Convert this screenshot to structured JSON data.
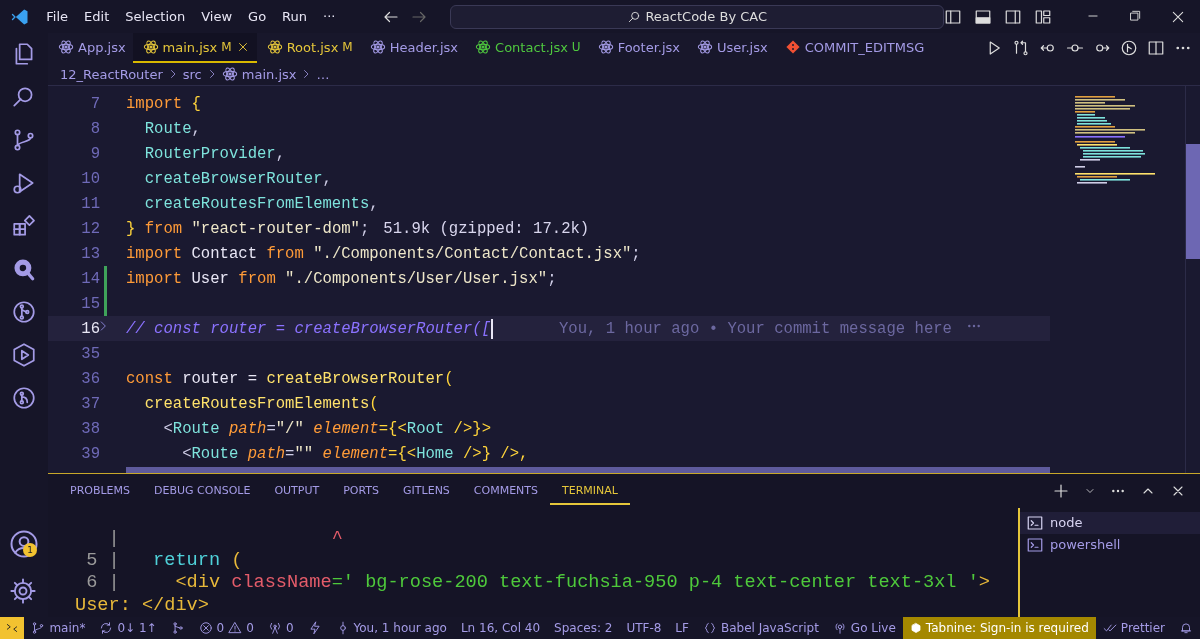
{
  "window": {
    "title": "ReactCode By CAC"
  },
  "menu": [
    "File",
    "Edit",
    "Selection",
    "View",
    "Go",
    "Run",
    "···"
  ],
  "tabs": [
    {
      "label": "App.jsx",
      "kind": "component",
      "selected": false
    },
    {
      "label": "main.jsx",
      "kind": "component",
      "status": "M",
      "selected": true
    },
    {
      "label": "Root.jsx",
      "kind": "component",
      "status": "M",
      "selected": false
    },
    {
      "label": "Header.jsx",
      "kind": "component",
      "selected": false
    },
    {
      "label": "Contact.jsx",
      "kind": "component",
      "status": "U",
      "selected": false
    },
    {
      "label": "Footer.jsx",
      "kind": "component",
      "selected": false
    },
    {
      "label": "User.jsx",
      "kind": "component",
      "selected": false
    },
    {
      "label": "COMMIT_EDITMSG",
      "kind": "git",
      "selected": false
    }
  ],
  "breadcrumbs": [
    "12_ReactRouter",
    "src",
    "main.jsx",
    "…"
  ],
  "code_lines": [
    {
      "number": "7",
      "git_added": false,
      "folded": false,
      "current": false,
      "tokens": [
        {
          "text": "import",
          "kind": "kw"
        },
        {
          "text": " {",
          "kind": "brace"
        }
      ]
    },
    {
      "number": "8",
      "git_added": false,
      "folded": false,
      "current": false,
      "tokens": [
        {
          "text": "  Route",
          "kind": "ident"
        },
        {
          "text": ",",
          "kind": "punc"
        }
      ]
    },
    {
      "number": "9",
      "git_added": false,
      "folded": false,
      "current": false,
      "tokens": [
        {
          "text": "  RouterProvider",
          "kind": "ident"
        },
        {
          "text": ",",
          "kind": "punc"
        }
      ]
    },
    {
      "number": "10",
      "git_added": false,
      "folded": false,
      "current": false,
      "tokens": [
        {
          "text": "  createBrowserRouter",
          "kind": "ident"
        },
        {
          "text": ",",
          "kind": "punc"
        }
      ]
    },
    {
      "number": "11",
      "git_added": false,
      "folded": false,
      "current": false,
      "tokens": [
        {
          "text": "  createRoutesFromElements",
          "kind": "ident"
        },
        {
          "text": ",",
          "kind": "punc"
        }
      ]
    },
    {
      "number": "12",
      "git_added": false,
      "folded": false,
      "current": false,
      "hint": "51.9k (gzipped: 17.2k)",
      "tokens": [
        {
          "text": "} ",
          "kind": "brace"
        },
        {
          "text": "from",
          "kind": "kw"
        },
        {
          "text": " \"react-router-dom\"",
          "kind": "str"
        },
        {
          "text": ";",
          "kind": "punc"
        }
      ]
    },
    {
      "number": "13",
      "git_added": false,
      "folded": false,
      "current": false,
      "tokens": [
        {
          "text": "import",
          "kind": "kw"
        },
        {
          "text": " Contact ",
          "kind": "name"
        },
        {
          "text": "from",
          "kind": "kw"
        },
        {
          "text": " \"./Components/Contact/Contact.jsx\"",
          "kind": "str"
        },
        {
          "text": ";",
          "kind": "punc"
        }
      ]
    },
    {
      "number": "14",
      "git_added": true,
      "folded": false,
      "current": false,
      "tokens": [
        {
          "text": "import",
          "kind": "kw"
        },
        {
          "text": " User ",
          "kind": "name"
        },
        {
          "text": "from",
          "kind": "kw"
        },
        {
          "text": " \"./Components/User/User.jsx\"",
          "kind": "str"
        },
        {
          "text": ";",
          "kind": "punc"
        }
      ]
    },
    {
      "number": "15",
      "git_added": true,
      "folded": false,
      "current": false
    },
    {
      "number": "16",
      "git_added": false,
      "folded": true,
      "current": true,
      "blame": "You, 1 hour ago • Your commit message here",
      "tokens": [
        {
          "text": "// const router = createBrowserRouter([",
          "kind": "comment"
        }
      ]
    },
    {
      "number": "35",
      "git_added": false,
      "folded": false,
      "current": false
    },
    {
      "number": "36",
      "git_added": false,
      "folded": false,
      "current": false,
      "tokens": [
        {
          "text": "const",
          "kind": "kw"
        },
        {
          "text": " router = ",
          "kind": "name"
        },
        {
          "text": "createBrowserRouter",
          "kind": "fn"
        },
        {
          "text": "(",
          "kind": "brace"
        }
      ]
    },
    {
      "number": "37",
      "git_added": false,
      "folded": false,
      "current": false,
      "tokens": [
        {
          "text": "  createRoutesFromElements",
          "kind": "fn"
        },
        {
          "text": "(",
          "kind": "brace"
        }
      ]
    },
    {
      "number": "38",
      "git_added": false,
      "folded": false,
      "current": false,
      "tokens": [
        {
          "text": "    <",
          "kind": "punc"
        },
        {
          "text": "Route",
          "kind": "tag"
        },
        {
          "text": " path",
          "kind": "attr"
        },
        {
          "text": "=",
          "kind": "punc"
        },
        {
          "text": "\"/\"",
          "kind": "str"
        },
        {
          "text": " element",
          "kind": "attr"
        },
        {
          "text": "={<",
          "kind": "brace"
        },
        {
          "text": "Root",
          "kind": "tag"
        },
        {
          "text": " />}>",
          "kind": "brace"
        }
      ]
    },
    {
      "number": "39",
      "git_added": false,
      "folded": false,
      "current": false,
      "tokens": [
        {
          "text": "      <",
          "kind": "punc"
        },
        {
          "text": "Route",
          "kind": "tag"
        },
        {
          "text": " path",
          "kind": "attr"
        },
        {
          "text": "=",
          "kind": "punc"
        },
        {
          "text": "\"\"",
          "kind": "str"
        },
        {
          "text": " element",
          "kind": "attr"
        },
        {
          "text": "={<",
          "kind": "brace"
        },
        {
          "text": "Home",
          "kind": "tag"
        },
        {
          "text": " />} />,",
          "kind": "brace"
        }
      ]
    }
  ],
  "panel_tabs": [
    {
      "label": "PROBLEMS",
      "selected": false
    },
    {
      "label": "DEBUG CONSOLE",
      "selected": false
    },
    {
      "label": "OUTPUT",
      "selected": false
    },
    {
      "label": "PORTS",
      "selected": false
    },
    {
      "label": "GITLENS",
      "selected": false
    },
    {
      "label": "COMMENTS",
      "selected": false
    },
    {
      "label": "TERMINAL",
      "selected": true
    }
  ],
  "terminal_lines": [
    [
      {
        "text": "   |                   ",
        "kind": "gray"
      },
      {
        "text": "^",
        "kind": "red"
      }
    ],
    [
      {
        "text": " 5 |   ",
        "kind": "gray"
      },
      {
        "text": "return",
        "kind": "cyan"
      },
      {
        "text": " (",
        "kind": "yellow"
      }
    ],
    [
      {
        "text": " 6 |     ",
        "kind": "gray"
      },
      {
        "text": "<div",
        "kind": "yellow"
      },
      {
        "text": " className",
        "kind": "red"
      },
      {
        "text": "=' bg-rose-200 text-fuchsia-950 p-4 text-center text-3xl '",
        "kind": "green"
      },
      {
        "text": ">",
        "kind": "yellow"
      }
    ],
    [
      {
        "text": "User: </div>",
        "kind": "yellow"
      }
    ]
  ],
  "terminal_sessions": [
    {
      "label": "node",
      "selected": true
    },
    {
      "label": "powershell",
      "selected": false
    }
  ],
  "activity_badge": "1",
  "status_bar": {
    "branch": "main*",
    "sync": "0↓ 1↑",
    "errors": "0",
    "warnings": "0",
    "ports": "0",
    "blame": "You, 1 hour ago",
    "position": "Ln 16, Col 40",
    "spaces": "Spaces: 2",
    "encoding": "UTF-8",
    "eol": "LF",
    "language": "Babel JavaScript",
    "live": "Go Live",
    "tabnine": "Tabnine: Sign-in is required",
    "prettier": "Prettier"
  }
}
